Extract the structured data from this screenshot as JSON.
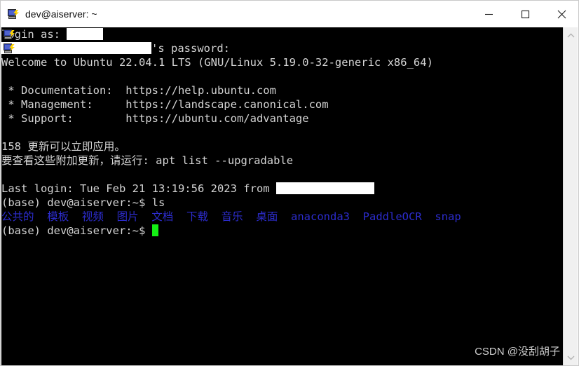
{
  "window": {
    "title": "dev@aiserver: ~",
    "icon": "putty-computer-icon",
    "controls": {
      "minimize_label": "Minimize",
      "maximize_label": "Maximize",
      "close_label": "Close"
    }
  },
  "terminal": {
    "background_color": "#000000",
    "foreground_color": "#d4d4d4",
    "directory_color": "#2c2ccc",
    "cursor_color": "#14f014",
    "lines": [
      {
        "id": "login-prompt",
        "pre": "login as: ",
        "masked": true,
        "mask_width": 52,
        "post": ""
      },
      {
        "id": "password-prompt",
        "pre": "",
        "masked": true,
        "mask_width": 214,
        "post": "'s password:"
      },
      {
        "id": "welcome",
        "text": "Welcome to Ubuntu 22.04.1 LTS (GNU/Linux 5.19.0-32-generic x86_64)"
      },
      {
        "id": "blank-1",
        "text": ""
      },
      {
        "id": "documentation",
        "text": " * Documentation:  https://help.ubuntu.com"
      },
      {
        "id": "management",
        "text": " * Management:     https://landscape.canonical.com"
      },
      {
        "id": "support",
        "text": " * Support:        https://ubuntu.com/advantage"
      },
      {
        "id": "blank-2",
        "text": ""
      },
      {
        "id": "updates-count",
        "text": "158 更新可以立即应用。"
      },
      {
        "id": "updates-hint",
        "text": "要查看这些附加更新，请运行: apt list --upgradable"
      },
      {
        "id": "blank-3",
        "text": ""
      },
      {
        "id": "last-login",
        "pre": "Last login: Tue Feb 21 13:19:56 2023 from ",
        "masked": true,
        "mask_width": 140,
        "post": ""
      },
      {
        "id": "prompt-ls",
        "text": "(base) dev@aiserver:~$ ls"
      }
    ],
    "ls_output": {
      "directories": [
        "公共的",
        "模板",
        "视频",
        "图片",
        "文档",
        "下载",
        "音乐",
        "桌面",
        "anaconda3",
        "PaddleOCR",
        "snap"
      ]
    },
    "final_prompt": "(base) dev@aiserver:~$ ",
    "cursor": "block-cursor"
  },
  "scrollbar": {
    "up_arrow": "chevron-up-icon",
    "down_arrow": "chevron-down-icon"
  },
  "watermark": {
    "text": "CSDN @没刮胡子"
  }
}
